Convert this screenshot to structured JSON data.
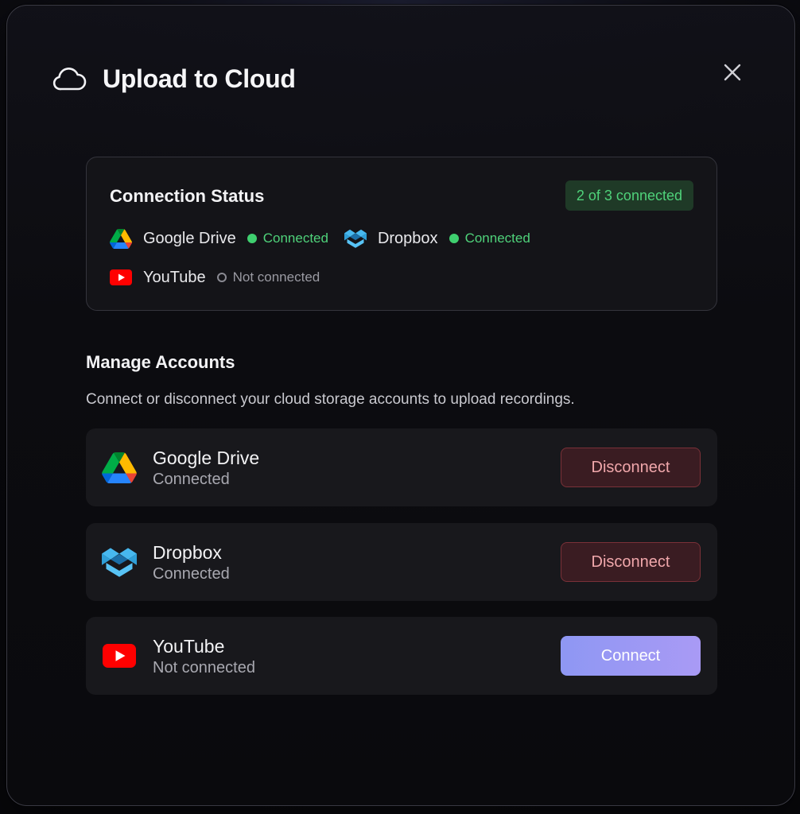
{
  "dialog": {
    "title": "Upload to Cloud",
    "close_icon": "close-icon",
    "header_icon": "cloud-icon"
  },
  "status": {
    "title": "Connection Status",
    "badge": "2 of 3 connected",
    "services": [
      {
        "name": "Google Drive",
        "status": "Connected",
        "icon": "google-drive-icon"
      },
      {
        "name": "Dropbox",
        "status": "Connected",
        "icon": "dropbox-icon"
      },
      {
        "name": "YouTube",
        "status": "Not connected",
        "icon": "youtube-icon"
      }
    ]
  },
  "manage": {
    "title": "Manage Accounts",
    "description": "Connect or disconnect your cloud storage accounts to upload recordings.",
    "accounts": [
      {
        "name": "Google Drive",
        "status": "Connected",
        "action": "Disconnect",
        "icon": "google-drive-icon"
      },
      {
        "name": "Dropbox",
        "status": "Connected",
        "action": "Disconnect",
        "icon": "dropbox-icon"
      },
      {
        "name": "YouTube",
        "status": "Not connected",
        "action": "Connect",
        "icon": "youtube-icon"
      }
    ]
  },
  "colors": {
    "connected": "#4fd27a",
    "disconnect_bg": "#3a1c22",
    "connect_accent": "#8e97f3"
  }
}
